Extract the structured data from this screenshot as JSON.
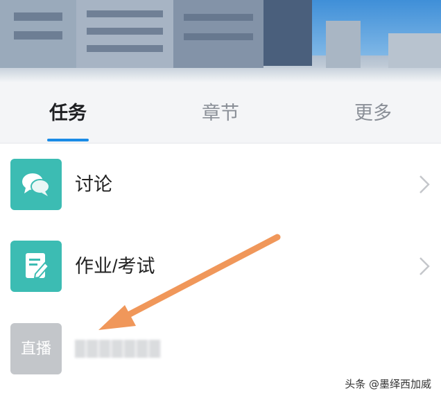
{
  "tabs": [
    {
      "label": "任务",
      "active": true
    },
    {
      "label": "章节",
      "active": false
    },
    {
      "label": "更多",
      "active": false
    }
  ],
  "list": [
    {
      "label": "讨论",
      "icon": "chat-bubbles-icon",
      "icon_color": "#3cbcb3"
    },
    {
      "label": "作业/考试",
      "icon": "edit-document-icon",
      "icon_color": "#3cbcb3"
    },
    {
      "label": "",
      "icon_text": "直播",
      "icon": "live-icon",
      "icon_color": "#c3c6ca"
    }
  ],
  "annotation": {
    "arrow_color": "#f0975a"
  },
  "watermark": "头条 @墨绎西加威",
  "accent": "#1a8be6"
}
